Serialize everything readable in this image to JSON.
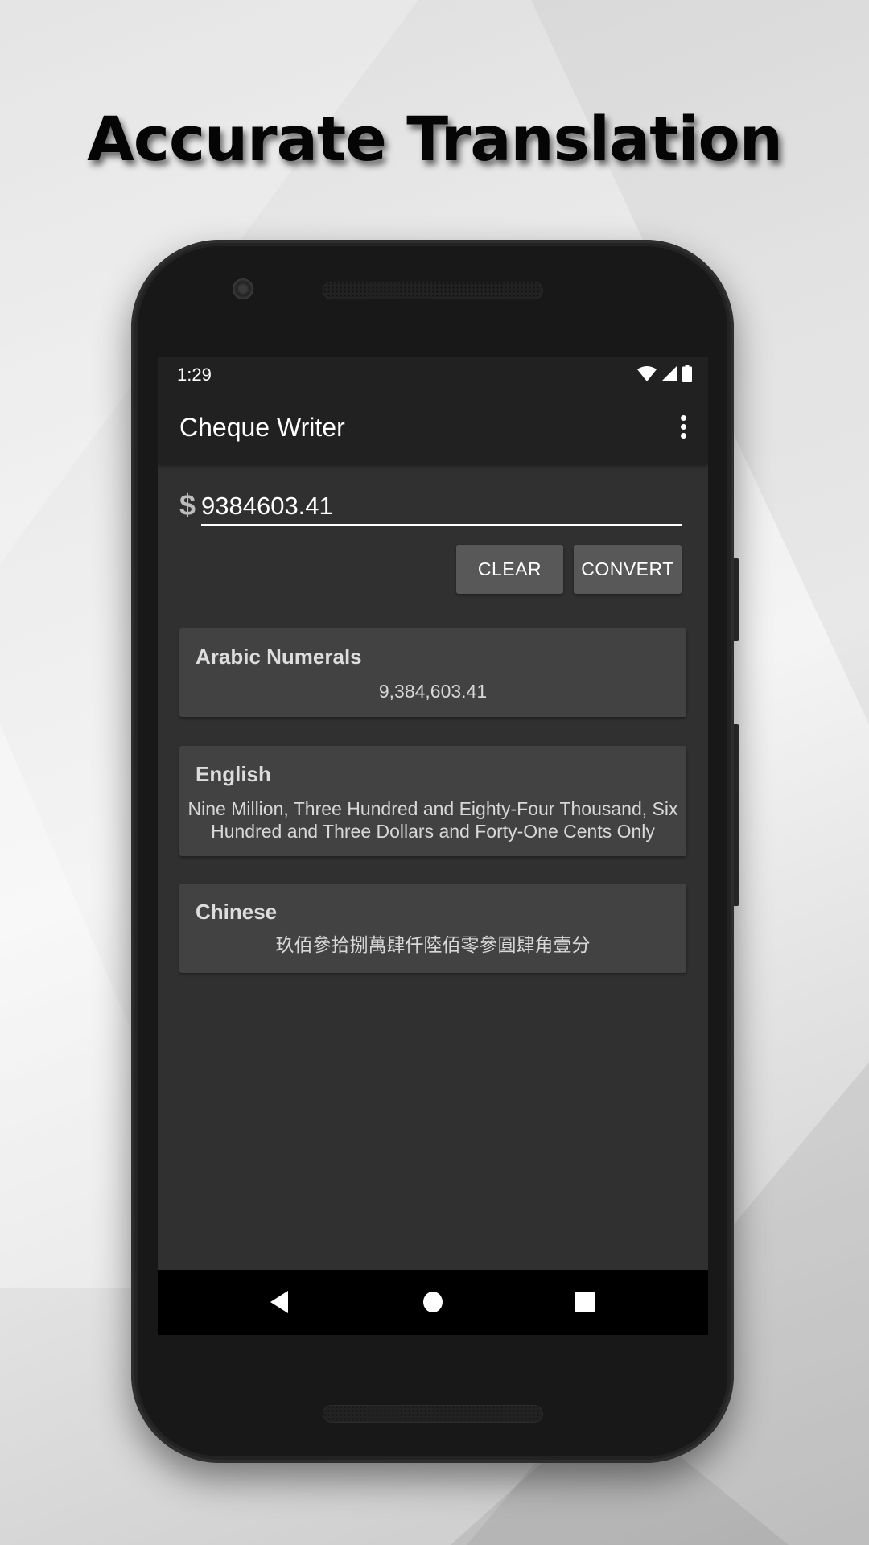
{
  "headline": "Accurate Translation",
  "status_bar": {
    "time": "1:29",
    "icons": [
      "wifi-icon",
      "cellular-signal-icon",
      "battery-icon"
    ]
  },
  "app_bar": {
    "title": "Cheque Writer",
    "overflow_icon": "more-vert-icon"
  },
  "input": {
    "currency_symbol": "$",
    "value": "9384603.41",
    "placeholder": ""
  },
  "buttons": {
    "clear": "CLEAR",
    "convert": "CONVERT"
  },
  "results": [
    {
      "title": "Arabic Numerals",
      "text": "9,384,603.41"
    },
    {
      "title": "English",
      "text": "Nine Million, Three Hundred and Eighty-Four Thousand, Six Hundred and Three Dollars and Forty-One Cents Only"
    },
    {
      "title": "Chinese",
      "text": "玖佰參拾捌萬肆仟陸佰零參圓肆角壹分"
    }
  ],
  "nav_bar": {
    "icons": [
      "back-icon",
      "home-icon",
      "recents-icon"
    ]
  },
  "colors": {
    "app_bar": "#212121",
    "background": "#303030",
    "card": "#424242",
    "button": "#585858",
    "nav_bar": "#000000"
  }
}
